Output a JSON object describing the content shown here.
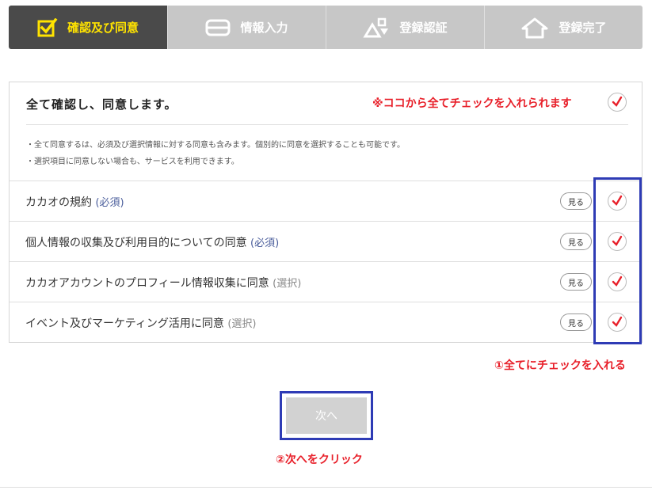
{
  "steps": [
    {
      "label": "確認及び同意",
      "icon": "check-box-icon",
      "active": true
    },
    {
      "label": "情報入力",
      "icon": "input-field-icon",
      "active": false
    },
    {
      "label": "登録認証",
      "icon": "shapes-icon",
      "active": false
    },
    {
      "label": "登録完了",
      "icon": "house-icon",
      "active": false
    }
  ],
  "agree_all": {
    "title": "全て確認し、同意します。",
    "note": "※ココから全てチェックを入れられます",
    "desc_1": "・全て同意するは、必須及び選択情報に対する同意も含みます。個別的に同意を選択することも可能です。",
    "desc_2": "・選択項目に同意しない場合も、サービスを利用できます。"
  },
  "terms": [
    {
      "label": "カカオの規約",
      "tag": "(必須)",
      "view": "見る"
    },
    {
      "label": "個人情報の収集及び利用目的についての同意",
      "tag": "(必須)",
      "view": "見る"
    },
    {
      "label": "カカオアカウントのプロフィール情報収集に同意",
      "tag": "(選択)",
      "view": "見る"
    },
    {
      "label": "イベント及びマーケティング活用に同意",
      "tag": "(選択)",
      "view": "見る"
    }
  ],
  "annotation_1": "①全てにチェックを入れる",
  "next_button": "次へ",
  "annotation_2": "②次へをクリック",
  "colors": {
    "accent_yellow": "#ffe300",
    "check_red": "#e8202a",
    "highlight_blue": "#2e3bb5"
  }
}
